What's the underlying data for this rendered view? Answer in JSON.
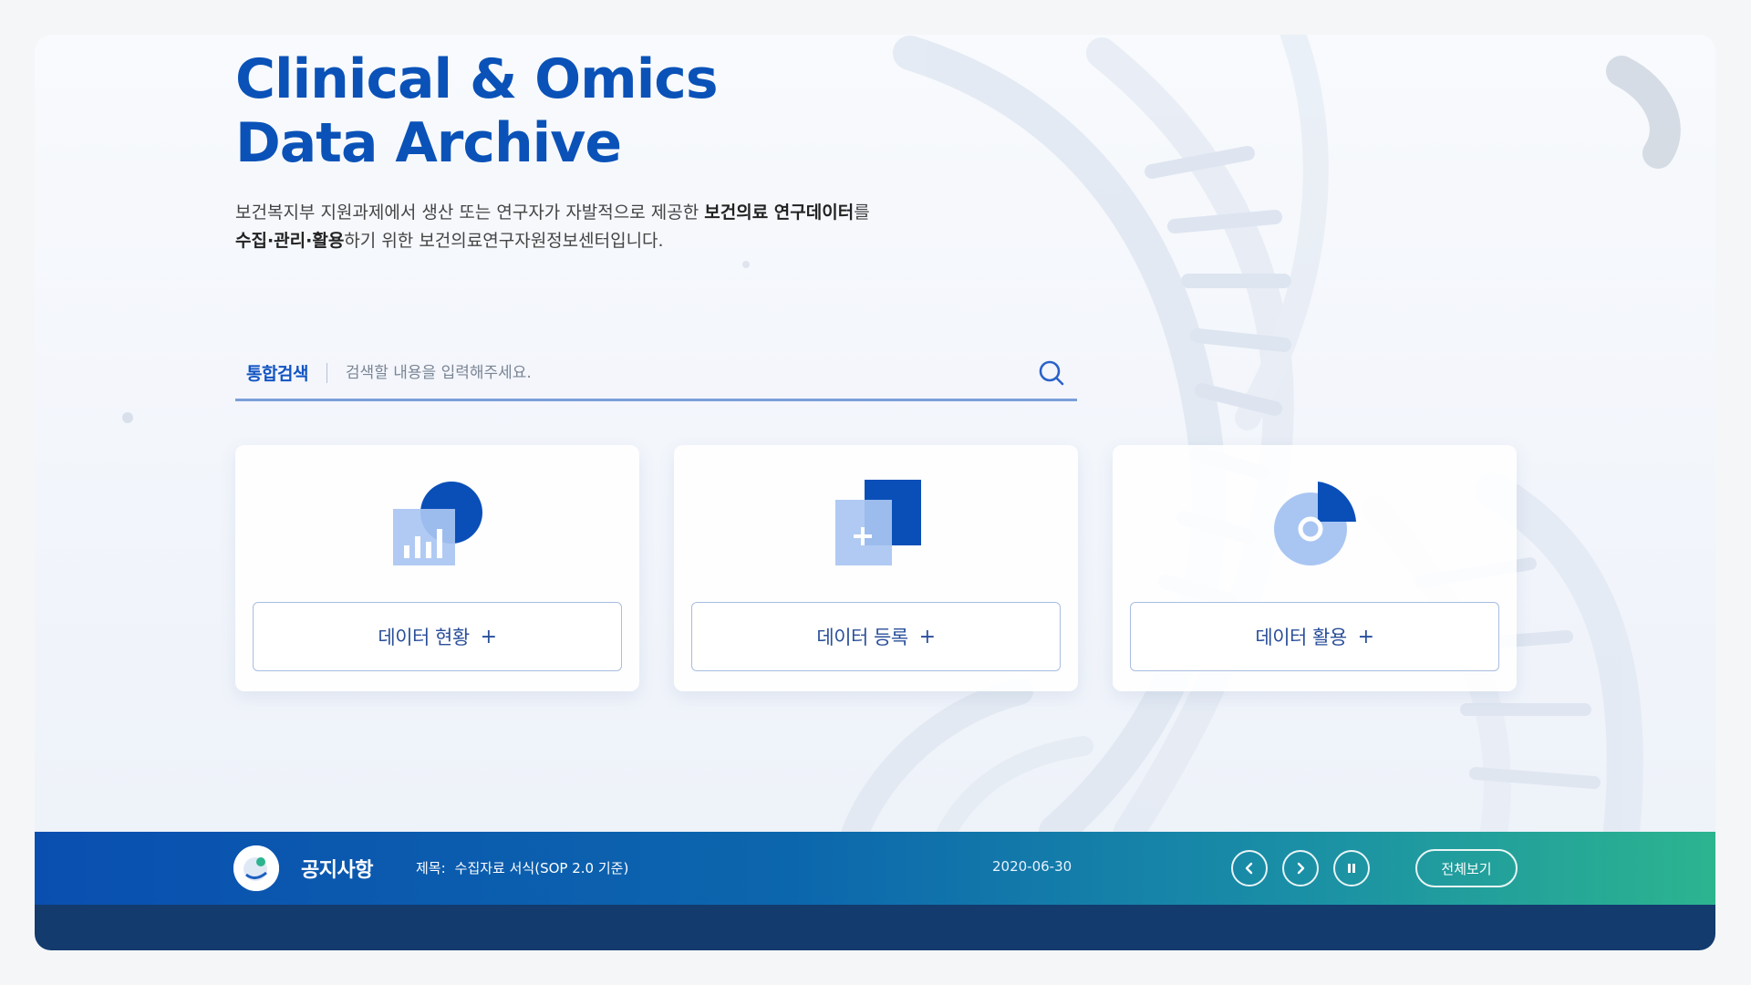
{
  "hero": {
    "title_line1": "Clinical & Omics",
    "title_line2": "Data Archive",
    "desc_part1": "보건복지부 지원과제에서 생산 또는 연구자가 자발적으로 제공한 ",
    "desc_bold1": "보건의료 연구데이터",
    "desc_part2": "를",
    "desc_bold2": "수집·관리·활용",
    "desc_part3": "하기 위한 보건의료연구자원정보센터입니다."
  },
  "search": {
    "label": "통합검색",
    "placeholder": "검색할 내용을 입력해주세요.",
    "value": "",
    "icon": "search-icon"
  },
  "cards": [
    {
      "label": "데이터 현황",
      "plus": "+",
      "icon": "bar-chart-icon"
    },
    {
      "label": "데이터 등록",
      "plus": "+",
      "icon": "document-add-icon"
    },
    {
      "label": "데이터 활용",
      "plus": "+",
      "icon": "pie-chart-icon"
    }
  ],
  "notice": {
    "title": "공지사항",
    "item_label": "제목:",
    "item_text": "수집자료 서식(SOP 2.0 기준)",
    "date": "2020-06-30",
    "view_all": "전체보기",
    "icons": [
      "chevron-left-icon",
      "chevron-right-icon",
      "pause-icon"
    ]
  },
  "colors": {
    "title": "#0a52b8",
    "accent": "#1254c2",
    "notice_start": "#0a4fb0",
    "notice_end": "#2cb48f",
    "footer": "#133b6e"
  }
}
